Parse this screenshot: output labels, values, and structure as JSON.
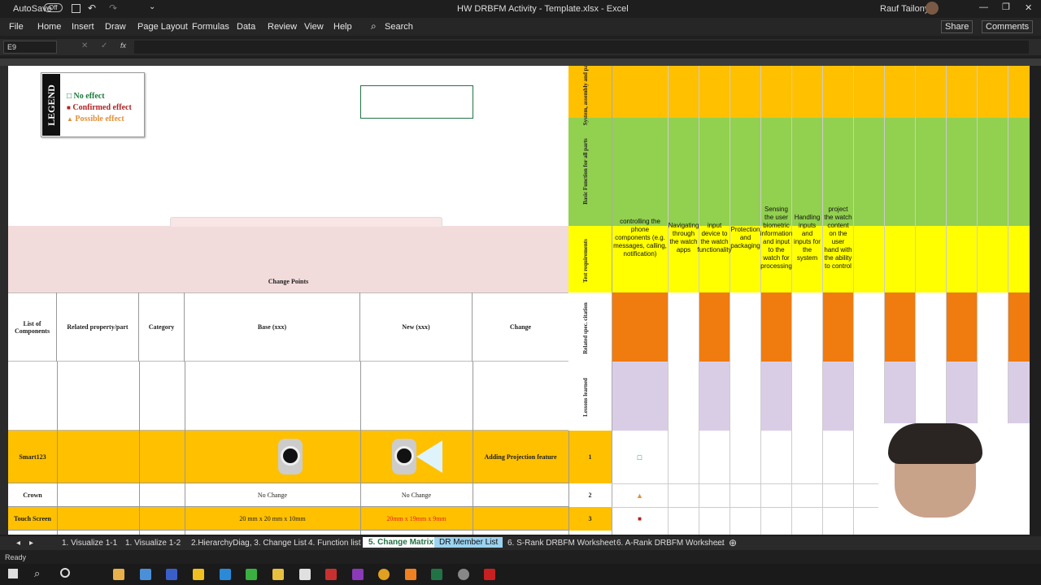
{
  "window": {
    "autosave": "AutoSave",
    "autosave_state": "Off",
    "title": "HW DRBFM Activity - Template.xlsx - Excel",
    "user": "Rauf Tailony"
  },
  "ribbon": {
    "tabs": [
      "File",
      "Home",
      "Insert",
      "Draw",
      "Page Layout",
      "Formulas",
      "Data",
      "Review",
      "View",
      "Help"
    ],
    "search": "Search",
    "share": "Share",
    "comments": "Comments"
  },
  "formula_bar": {
    "name_box": "E9",
    "fx": "fx"
  },
  "legend": {
    "title": "LEGEND",
    "items": [
      {
        "symbol": "□",
        "label": "No effect",
        "color": "#1a7a3a"
      },
      {
        "symbol": "■",
        "label": "Confirmed effect",
        "color": "#b22222"
      },
      {
        "symbol": "▲",
        "label": "Possible effect",
        "color": "#e0903a"
      }
    ]
  },
  "section": {
    "change_points": "Change Points"
  },
  "headers": {
    "list": "List of Components",
    "related": "Related property/part",
    "category": "Category",
    "base": "Base (xxx)",
    "new": "New (xxx)",
    "change": "Change"
  },
  "row_labels": {
    "system": "System, assembly and parts",
    "basic": "Basic Function for all parts",
    "test": "Test requirements",
    "spec": "Related spec. citation",
    "lessons": "Lessons learned"
  },
  "functions": [
    "controlling the phone components (e.g. messages, calling, notification)",
    "Navigating through the watch apps",
    "input device to the watch functionality",
    "Protection and packaging",
    "Sensing the user biometric information and input to the watch for processing",
    "Handling inputs and inputs for the system",
    "project the watch content on the user hand with the ability to control"
  ],
  "rows": [
    {
      "component": "Smart123",
      "base": "",
      "new": "",
      "change": "Adding Projection feature",
      "num": "1",
      "mark": "□"
    },
    {
      "component": "Crown",
      "base": "No Change",
      "new": "No Change",
      "change": "",
      "num": "2",
      "mark": "▲"
    },
    {
      "component": "Touch Screen",
      "base": "20 mm x 20 mm x 10mm",
      "new": "20mm x 19mm x 9mm",
      "change": "",
      "num": "3",
      "mark": "■"
    }
  ],
  "sheet_tabs": [
    "1. Visualize 1-1",
    "1. Visualize 1-2",
    "2.HierarchyDiag, 3. Change List",
    "4. Function list",
    "5. Change Matrix",
    "DR Member List",
    "6. S-Rank DRBFM Worksheet",
    "6. A-Rank DRBFM Worksheet"
  ],
  "active_tab": "5. Change Matrix",
  "status": {
    "ready": "Ready"
  },
  "colors": {
    "orange": "#ffc000",
    "green": "#92d050",
    "yellow": "#ffff00",
    "dark_orange": "#f07b0f",
    "lavender": "#d9cde6",
    "pink": "#f2dcdb"
  }
}
